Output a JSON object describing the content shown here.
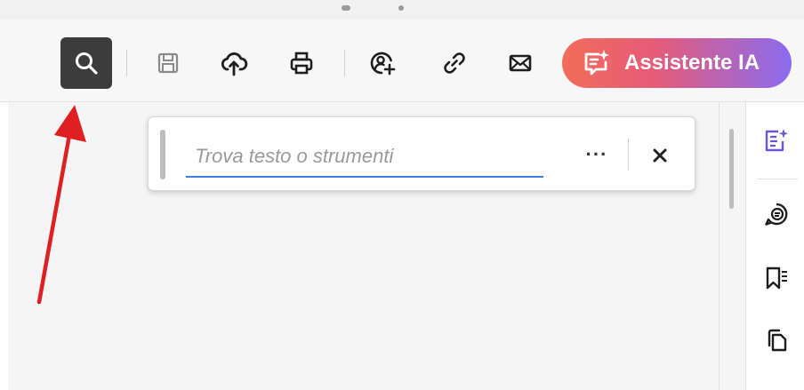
{
  "toolbar": {
    "buttons": [
      {
        "name": "search-icon",
        "active": true
      },
      {
        "name": "save-icon"
      },
      {
        "name": "cloud-upload-icon"
      },
      {
        "name": "print-icon"
      },
      {
        "name": "share-user-icon"
      },
      {
        "name": "link-icon"
      },
      {
        "name": "mail-icon"
      }
    ],
    "ai_button_label": "Assistente IA",
    "ai_icon": "ai-chat-sparkle-icon"
  },
  "find_panel": {
    "placeholder": "Trova testo o strumenti",
    "value": "",
    "more_label": "···",
    "close_icon": "close-icon"
  },
  "right_panel": {
    "icons": [
      "ai-summary-icon",
      "comment-icon",
      "bookmark-icon",
      "pages-icon"
    ]
  },
  "colors": {
    "accent_blue": "#3b82e6",
    "ai_gradient_start": "#f26c5a",
    "ai_gradient_end": "#8a6cf0",
    "ai_icon_purple": "#6a55e0",
    "annotation_arrow": "#e02020",
    "active_button_bg": "#3c3c3c"
  }
}
